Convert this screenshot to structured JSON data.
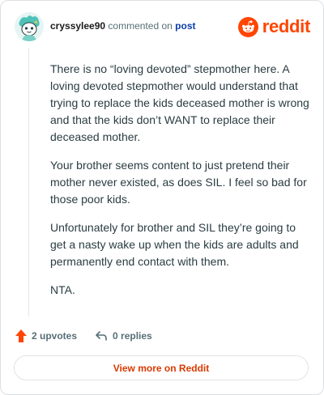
{
  "header": {
    "username": "cryssylee90",
    "action_text": "commented on",
    "link_text": "post",
    "brand": "reddit",
    "avatar_icon": "snoo-avatar-icon",
    "brand_icon": "reddit-snoo-icon"
  },
  "comment": {
    "paragraphs": [
      "There is no “loving devoted” stepmother here. A loving devoted stepmother would understand that trying to replace the kids deceased mother is wrong and that the kids don’t WANT to replace their deceased mother.",
      "Your brother seems content to just pretend their mother never existed, as does SIL. I feel so bad for those poor kids.",
      "Unfortunately for brother and SIL they’re going to get a nasty wake up when the kids are adults and permanently end contact with them.",
      "NTA."
    ]
  },
  "actions": {
    "upvotes": "2 upvotes",
    "replies": "0 replies",
    "upvote_icon": "upvote-arrow-icon",
    "reply_icon": "reply-arrow-icon"
  },
  "footer": {
    "view_more": "View more on Reddit"
  },
  "colors": {
    "brand": "#ff4500",
    "link": "#0a3ea8",
    "view_more": "#d93a00",
    "muted": "#576f76"
  }
}
